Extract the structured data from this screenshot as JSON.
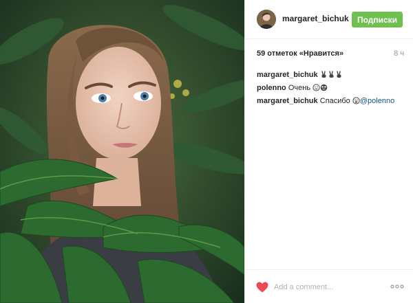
{
  "post": {
    "author": {
      "username": "margaret_bichuk",
      "avatar_icon": "profile-photo-avatar"
    },
    "follow_label": "Подписки",
    "likes_label": "59 отметок «Нравится»",
    "timestamp": "8 ч",
    "comments": [
      {
        "user": "margaret_bichuk",
        "text": "",
        "emojis": [
          "victory-hand-emoji",
          "victory-hand-emoji",
          "victory-hand-emoji"
        ]
      },
      {
        "user": "polenno",
        "text": "Очень",
        "emojis": [
          "smiling-face-emoji",
          "cool-face-emoji"
        ]
      },
      {
        "user": "margaret_bichuk",
        "text": "Спасибо",
        "emojis": [
          "surprised-face-emoji"
        ],
        "mention": "@polenno"
      }
    ],
    "comment_placeholder": "Add a comment...",
    "photo_description_icon": "portrait-photo"
  },
  "colors": {
    "follow_button": "#70c050",
    "heart": "#ed4956",
    "mention": "#125688",
    "timestamp": "#999999"
  }
}
